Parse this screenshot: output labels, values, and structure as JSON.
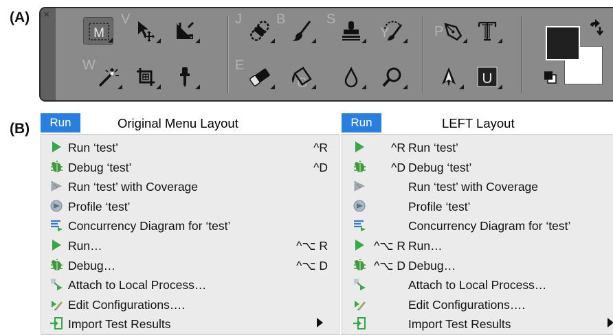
{
  "panel_labels": {
    "a": "(A)",
    "b": "(B)"
  },
  "toolbar": {
    "close_glyph": "×",
    "tool_keys": {
      "w": "W",
      "v": "V",
      "j": "J",
      "b": "B",
      "s": "S",
      "y": "Y",
      "e": "E",
      "g": "G",
      "p": "P"
    },
    "marquee_letter": "M",
    "quickmask_letter": "U",
    "colors": {
      "background": "#8a8a8a",
      "foreground_swatch": "#202020",
      "background_swatch": "#ffffff",
      "active_tool": "#6a6a6a"
    }
  },
  "menus": {
    "original": {
      "tab": "Run",
      "title": "Original Menu Layout",
      "items": [
        {
          "label": "Run ‘test’",
          "shortcut": "^R",
          "icon": "run-icon"
        },
        {
          "label": "Debug ‘test’",
          "shortcut": "^D",
          "icon": "debug-icon"
        },
        {
          "label": "Run ‘test’  with Coverage",
          "shortcut": "",
          "icon": "coverage-icon"
        },
        {
          "label": "Profile ‘test’",
          "shortcut": "",
          "icon": "profile-icon"
        },
        {
          "label": "Concurrency  Diagram for ‘test’",
          "shortcut": "",
          "icon": "concurrency-icon"
        },
        {
          "label": "Run…",
          "shortcut": "^⌥ R",
          "icon": "run-icon"
        },
        {
          "label": "Debug…",
          "shortcut": "^⌥ D",
          "icon": "debug-icon"
        },
        {
          "label": "Attach  to Local Process…",
          "shortcut": "",
          "icon": "attach-icon"
        },
        {
          "label": "Edit  Configurations….",
          "shortcut": "",
          "icon": "edit-config-icon"
        },
        {
          "label": "Import Test Results",
          "shortcut": "",
          "icon": "import-icon",
          "submenu": true
        }
      ]
    },
    "left": {
      "tab": "Run",
      "title": "LEFT Layout",
      "items": [
        {
          "label": "Run ‘test’",
          "shortcut": "^R",
          "icon": "run-icon"
        },
        {
          "label": "Debug ‘test’",
          "shortcut": "^D",
          "icon": "debug-icon"
        },
        {
          "label": "Run ‘test’  with Coverage",
          "shortcut": "",
          "icon": "coverage-icon"
        },
        {
          "label": "Profile ‘test’",
          "shortcut": "",
          "icon": "profile-icon"
        },
        {
          "label": "Concurrency  Diagram for ‘test’",
          "shortcut": "",
          "icon": "concurrency-icon"
        },
        {
          "label": "Run…",
          "shortcut": "^⌥ R",
          "icon": "run-icon"
        },
        {
          "label": "Debug…",
          "shortcut": "^⌥ D",
          "icon": "debug-icon"
        },
        {
          "label": "Attach  to Local Process…",
          "shortcut": "",
          "icon": "attach-icon"
        },
        {
          "label": "Edit  Configurations….",
          "shortcut": "",
          "icon": "edit-config-icon"
        },
        {
          "label": "Import Test Results",
          "shortcut": "",
          "icon": "import-icon",
          "submenu": true
        }
      ]
    }
  }
}
